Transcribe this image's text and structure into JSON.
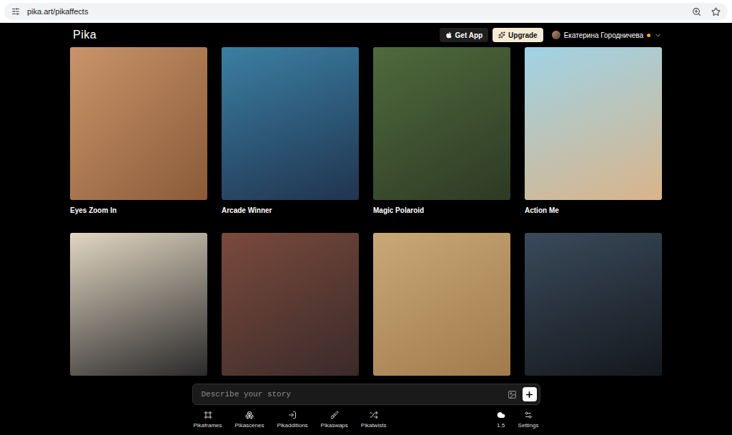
{
  "browser": {
    "url": "pika.art/pikaffects"
  },
  "header": {
    "logo": "Pika",
    "get_app": "Get App",
    "upgrade": "Upgrade",
    "user": {
      "name": "Екатерина Городничева",
      "notification": true
    }
  },
  "gallery": {
    "rows": [
      {
        "cards": [
          {
            "title": "Eyes Zoom In"
          },
          {
            "title": "Arcade Winner"
          },
          {
            "title": "Magic Polaroid"
          },
          {
            "title": "Action Me"
          }
        ]
      },
      {
        "cards": [
          {},
          {},
          {},
          {}
        ]
      }
    ]
  },
  "prompt": {
    "placeholder": "Describe your story"
  },
  "nav": {
    "tools": [
      {
        "label": "Pikaframes"
      },
      {
        "label": "Pikascenes"
      },
      {
        "label": "Pikadditions"
      },
      {
        "label": "Pikaswaps"
      },
      {
        "label": "Pikatwists"
      }
    ],
    "model": {
      "label": "1.5"
    },
    "settings": {
      "label": "Settings"
    }
  }
}
